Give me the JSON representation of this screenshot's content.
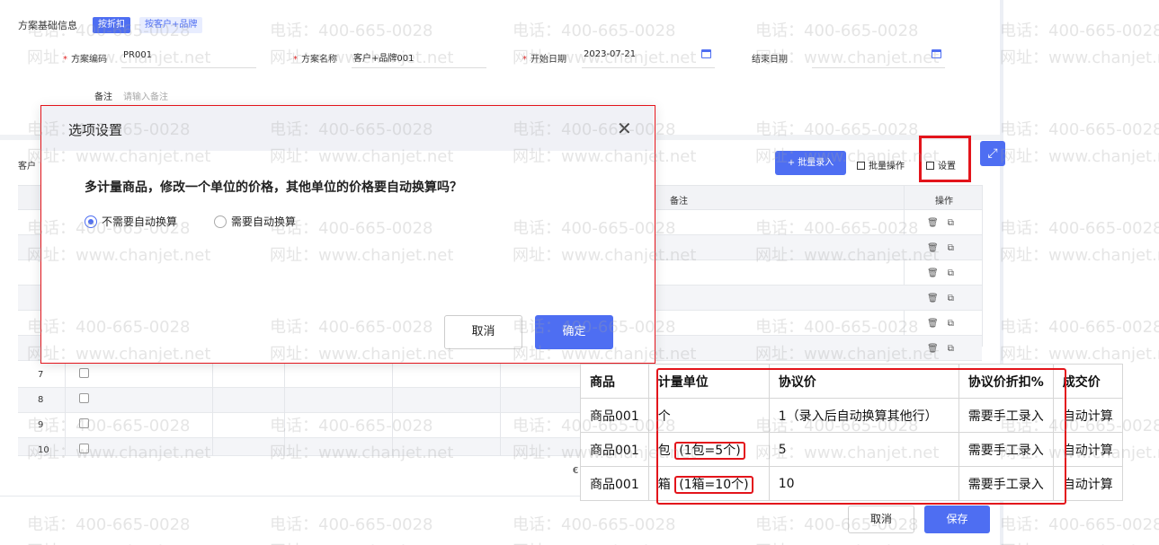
{
  "header": {
    "section_title": "方案基础信息",
    "tag_discount": "按折扣",
    "tag_customer_brand": "按客户+品牌"
  },
  "form": {
    "code_label": "方案编码",
    "code_value": "PR001",
    "name_label": "方案名称",
    "name_value": "客户+品牌001",
    "start_label": "开始日期",
    "start_value": "2023-07-21",
    "end_label": "结束日期",
    "note_label": "备注",
    "note_placeholder": "请输入备注"
  },
  "toolbar": {
    "customer_label": "客户",
    "batch_entry": "+ 批量录入",
    "batch_ops": "批量操作",
    "settings": "设置",
    "expand_icon": "expand-icon"
  },
  "bg_table": {
    "col_note": "备注",
    "col_ops": "操作",
    "row_numbers": [
      "7",
      "8",
      "9",
      "10"
    ],
    "fragment_text": "€"
  },
  "dialog": {
    "title": "选项设置",
    "question": "多计量商品，修改一个单位的价格，其他单位的价格要自动换算吗？",
    "option_no": "不需要自动换算",
    "option_yes": "需要自动换算",
    "selected": "不需要自动换算",
    "cancel": "取消",
    "ok": "确定"
  },
  "explain_table": {
    "headers": [
      "商品",
      "计量单位",
      "协议价",
      "协议价折扣%",
      "成交价"
    ],
    "rows": [
      {
        "product": "商品001",
        "unit": "个",
        "unit_note": "",
        "price": "1（录入后自动换算其他行）",
        "discount": "需要手工录入",
        "deal": "自动计算"
      },
      {
        "product": "商品001",
        "unit": "包",
        "unit_note": "(1包=5个)",
        "price": "5",
        "discount": "需要手工录入",
        "deal": "自动计算"
      },
      {
        "product": "商品001",
        "unit": "箱",
        "unit_note": "(1箱=10个)",
        "price": "10",
        "discount": "需要手工录入",
        "deal": "自动计算"
      }
    ]
  },
  "footer": {
    "cancel": "取消",
    "save": "保存"
  },
  "watermark": {
    "phone": "电话：400-665-0028",
    "site": "网址：www.chanjet.net"
  },
  "colors": {
    "primary": "#4e6ef2",
    "highlight_red": "#e3141b"
  }
}
